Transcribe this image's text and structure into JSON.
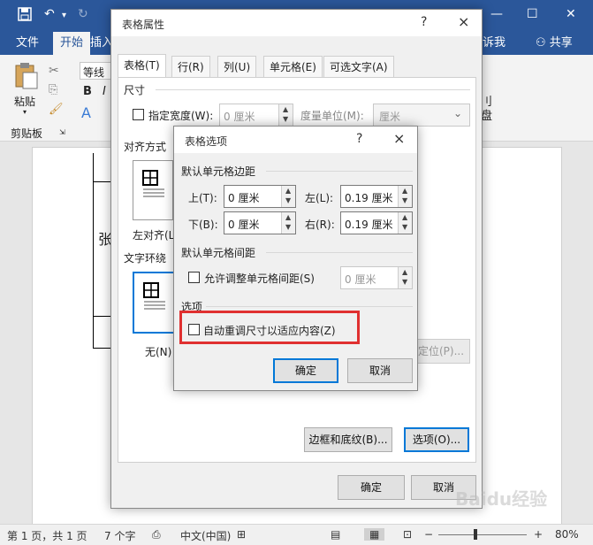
{
  "word": {
    "tabs": [
      "文件",
      "开始",
      "插入"
    ],
    "tabs_right": [
      "诉我",
      "共享"
    ],
    "clipboard": {
      "paste": "粘贴",
      "group": "剪贴板"
    },
    "font_box": "等线",
    "font_btns": [
      "B",
      "I",
      "A"
    ],
    "ribbon_right": [
      "刂",
      "盘"
    ],
    "doc_char": "张"
  },
  "status": {
    "page": "第 1 页，共 1 页",
    "words": "7 个字",
    "lang": "中文(中国)",
    "zoom": "80%",
    "watermark": "Baidu经验"
  },
  "table_props": {
    "title": "表格属性",
    "help": "?",
    "close": "×",
    "tabs": [
      "表格(T)",
      "行(R)",
      "列(U)",
      "单元格(E)",
      "可选文字(A)"
    ],
    "size_section": "尺寸",
    "width_check": "指定宽度(W):",
    "width_value": "0 厘米",
    "unit_label": "度量单位(M):",
    "unit_value": "厘米",
    "align_section": "对齐方式",
    "align_left": "左对齐(L)",
    "wrap_section": "文字环绕",
    "wrap_none": "无(N)",
    "position_btn": "定位(P)...",
    "borders_btn": "边框和底纹(B)...",
    "options_btn": "选项(O)...",
    "ok": "确定",
    "cancel": "取消"
  },
  "table_options": {
    "title": "表格选项",
    "help": "?",
    "close": "×",
    "margins_section": "默认单元格边距",
    "top_label": "上(T):",
    "top_value": "0 厘米",
    "left_label": "左(L):",
    "left_value": "0.19 厘米",
    "bottom_label": "下(B):",
    "bottom_value": "0 厘米",
    "right_label": "右(R):",
    "right_value": "0.19 厘米",
    "spacing_section": "默认单元格间距",
    "spacing_check": "允许调整单元格间距(S)",
    "spacing_value": "0 厘米",
    "options_section": "选项",
    "autofit_check": "自动重调尺寸以适应内容(Z)",
    "ok": "确定",
    "cancel": "取消"
  },
  "colors": {
    "brand": "#2b579a",
    "highlight": "#e03030",
    "focus": "#0078d7"
  }
}
